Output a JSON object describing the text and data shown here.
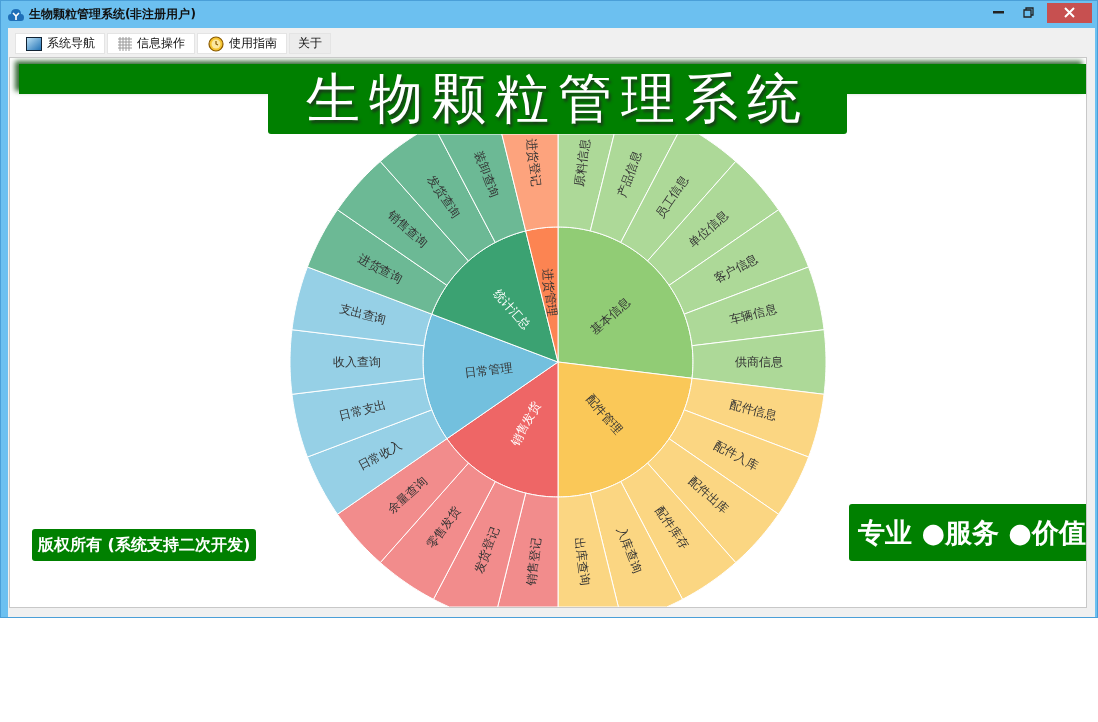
{
  "window": {
    "title": "生物颗粒管理系统(非注册用户)"
  },
  "menu": [
    {
      "label": "系统导航",
      "selected": false
    },
    {
      "label": "信息操作",
      "selected": false
    },
    {
      "label": "使用指南",
      "selected": false
    },
    {
      "label": "关于",
      "selected": true
    }
  ],
  "banner": {
    "title": "生物颗粒管理系统"
  },
  "sunburst": {
    "groups": [
      {
        "label": "基本信息",
        "color": "#91cc75",
        "children": [
          {
            "label": "原料信息"
          },
          {
            "label": "产品信息"
          },
          {
            "label": "员工信息"
          },
          {
            "label": "单位信息"
          },
          {
            "label": "客户信息"
          },
          {
            "label": "车辆信息"
          },
          {
            "label": "供商信息"
          }
        ]
      },
      {
        "label": "配件管理",
        "color": "#fac858",
        "children": [
          {
            "label": "配件信息"
          },
          {
            "label": "配件入库"
          },
          {
            "label": "配件出库"
          },
          {
            "label": "配件库存"
          },
          {
            "label": "入库查询"
          },
          {
            "label": "出库查询"
          }
        ]
      },
      {
        "label": "销售发货",
        "color": "#ee6666",
        "children": [
          {
            "label": "销售登记"
          },
          {
            "label": "发货登记"
          },
          {
            "label": "零售发货"
          },
          {
            "label": "余量查询"
          }
        ]
      },
      {
        "label": "日常管理",
        "color": "#73c0de",
        "children": [
          {
            "label": "日常收入"
          },
          {
            "label": "日常支出"
          },
          {
            "label": "收入查询"
          },
          {
            "label": "支出查询"
          }
        ]
      },
      {
        "label": "统计汇总",
        "color": "#3ba272",
        "children": [
          {
            "label": "进货查询"
          },
          {
            "label": "销售查询"
          },
          {
            "label": "发货查询"
          },
          {
            "label": "装卸查询"
          }
        ]
      },
      {
        "label": "进货管理",
        "color": "#fc8452",
        "children": [
          {
            "label": "进货登记"
          }
        ]
      }
    ]
  },
  "copyright": "版权所有 (系统支持二次开发)",
  "slogan": "专业 ●服务 ●价值"
}
